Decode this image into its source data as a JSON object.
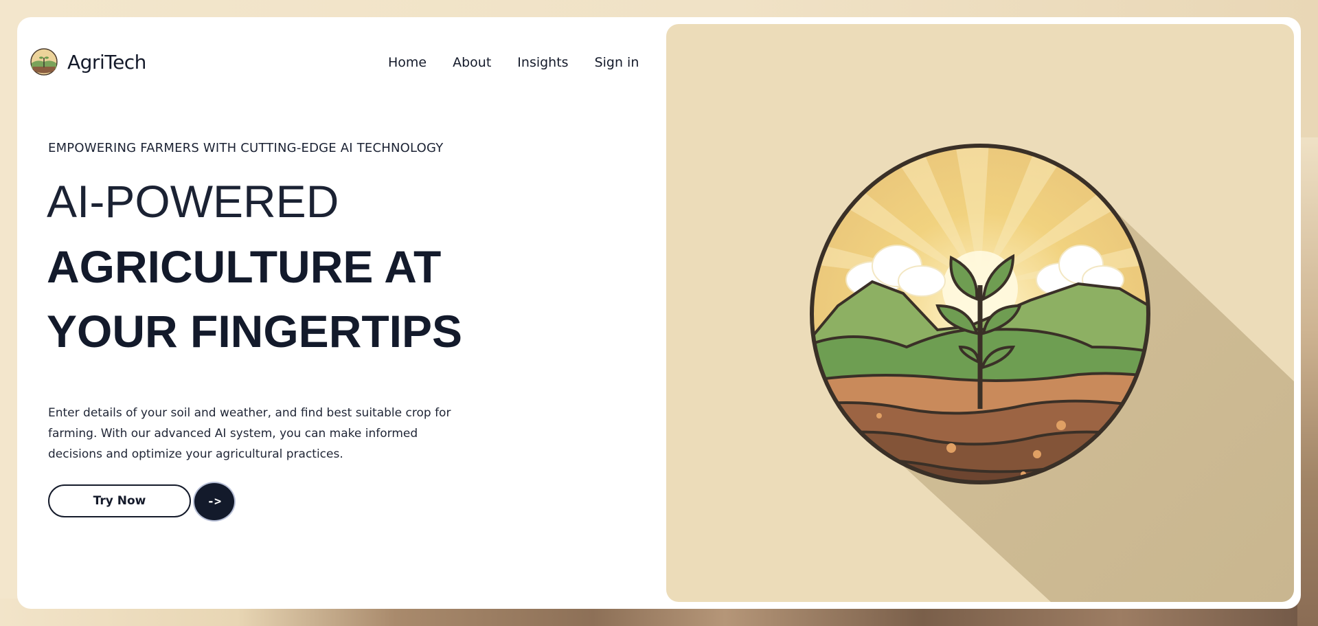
{
  "brand": {
    "name": "AgriTech",
    "logo_icon": "farm-landscape-logo-icon"
  },
  "nav": {
    "items": [
      {
        "label": "Home"
      },
      {
        "label": "About"
      },
      {
        "label": "Insights"
      },
      {
        "label": "Sign in"
      }
    ]
  },
  "hero": {
    "eyebrow": "EMPOWERING FARMERS WITH CUTTING-EDGE AI TECHNOLOGY",
    "headline_light": "AI-POWERED",
    "headline_bold_line1": "AGRICULTURE AT",
    "headline_bold_line2": "YOUR FINGERTIPS",
    "description": "Enter details of your soil and weather, and find best suitable crop for farming. With our advanced AI system, you can make informed decisions and optimize your agricultural practices.",
    "try_label": "Try Now",
    "arrow_label": "->",
    "illustration_icon": "sprout-landscape-illustration"
  },
  "colors": {
    "page_bg": "#f3e6cc",
    "card_bg": "#ffffff",
    "hero_panel_bg": "#ecdcb9",
    "text_dark": "#131a2b",
    "arrow_button_bg": "#131a2b"
  }
}
